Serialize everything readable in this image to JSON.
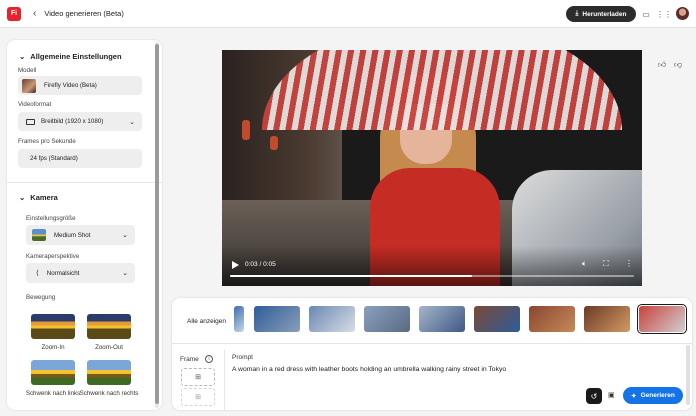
{
  "header": {
    "logo_text": "Fi",
    "back_icon": "chevron-left-icon",
    "title": "Video generieren (Beta)",
    "download_label": "Herunterladen",
    "icons": [
      "comment-icon",
      "apps-grid-icon",
      "avatar"
    ]
  },
  "settings": {
    "general": {
      "title": "Allgemeine Einstellungen",
      "model_label": "Modell",
      "model_value": "Firefly Video (Beta)",
      "format_label": "Videoformat",
      "format_value": "Breitbild (1920 x 1080)",
      "fps_label": "Frames pro Sekunde",
      "fps_value": "24 fps (Standard)"
    },
    "camera": {
      "title": "Kamera",
      "shot_label": "Einstellungsgröße",
      "shot_value": "Medium Shot",
      "angle_label": "Kameraperspektive",
      "angle_value": "Normalsicht",
      "motion_label": "Bewegung",
      "motions": [
        {
          "label": "Zoom-In"
        },
        {
          "label": "Zoom-Out"
        },
        {
          "label": "Schwenk nach links"
        },
        {
          "label": "Schwenk nach rechts"
        }
      ]
    }
  },
  "feedback": {
    "like_icon": "thumbs-up-icon",
    "dislike_icon": "thumbs-down-icon"
  },
  "video": {
    "current_time": "0:03",
    "duration": "0:05",
    "time_display": "0:03 / 0:05",
    "progress": 0.6
  },
  "frames": {
    "show_all_label": "Alle anzeigen",
    "thumbnails": [
      {
        "colors": [
          "#3a6fb0",
          "#c9d6e6"
        ]
      },
      {
        "colors": [
          "#2e5c9a",
          "#8a9fb8"
        ]
      },
      {
        "colors": [
          "#6a88b2",
          "#d8dde6"
        ]
      },
      {
        "colors": [
          "#8aa0bf",
          "#5a6a82"
        ]
      },
      {
        "colors": [
          "#a6b4c8",
          "#3e5a86"
        ]
      },
      {
        "colors": [
          "#7a4a34",
          "#2e5c9a"
        ]
      },
      {
        "colors": [
          "#8a4630",
          "#c68a5a"
        ]
      },
      {
        "colors": [
          "#6a3a24",
          "#d49a66"
        ]
      },
      {
        "colors": [
          "#c8423e",
          "#d0d0d0"
        ],
        "selected": true
      }
    ]
  },
  "prompt": {
    "frame_label": "Frame",
    "prompt_label": "Prompt",
    "text": "A woman in a red dress with leather boots holding an umbrella walking rainy street in Tokyo",
    "generate_label": "Generieren"
  }
}
